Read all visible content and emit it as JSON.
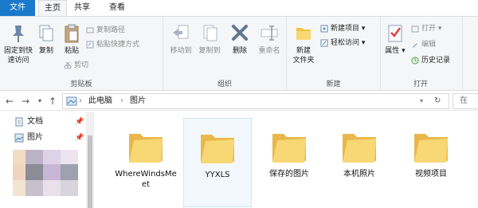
{
  "tabs": {
    "file": "文件",
    "home": "主页",
    "share": "共享",
    "view": "查看"
  },
  "ribbon": {
    "clipboard": {
      "pin": "固定到快\n速访问",
      "copy": "复制",
      "paste": "粘贴",
      "copy_path": "复制路径",
      "paste_shortcut": "粘贴快捷方式",
      "cut": "剪切",
      "label": "剪贴板"
    },
    "organize": {
      "move_to": "移动到",
      "copy_to": "复制到",
      "delete": "删除",
      "rename": "重命名",
      "label": "组织"
    },
    "new": {
      "new_folder": "新建\n文件夹",
      "new_item": "新建项目",
      "easy_access": "轻松访问",
      "label": "新建"
    },
    "open": {
      "properties": "属性",
      "open": "打开",
      "edit": "编辑",
      "history": "历史记录",
      "label": "打开"
    }
  },
  "address": {
    "crumbs": [
      "此电脑",
      "图片"
    ],
    "search_placeholder": "在"
  },
  "nav": {
    "items": [
      {
        "label": "文档"
      },
      {
        "label": "图片"
      }
    ]
  },
  "folders": [
    {
      "name": "WhereWindsMeet"
    },
    {
      "name": "YYXLS"
    },
    {
      "name": "保存的图片"
    },
    {
      "name": "本机照片"
    },
    {
      "name": "视频项目"
    }
  ],
  "colors": {
    "file_tab": "#1979ca",
    "selected_bg": "#f2f8fd",
    "selected_border": "#cce8ff",
    "folder": "#f8d775"
  }
}
